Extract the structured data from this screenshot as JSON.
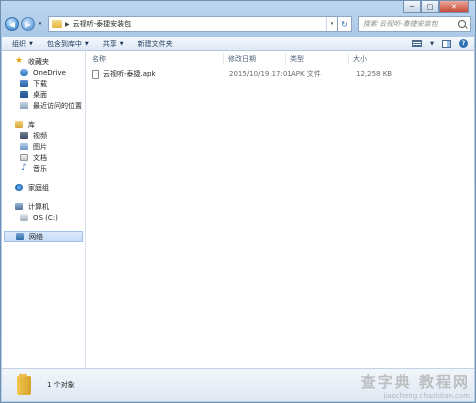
{
  "window": {
    "controls": {
      "minimize": "─",
      "maximize": "□",
      "close": "✕"
    }
  },
  "address_bar": {
    "back_icon": "◀",
    "forward_icon": "▶",
    "dropdown": "▾",
    "breadcrumb": [
      "云视听-泰捷安装包"
    ],
    "refresh": "↻"
  },
  "search": {
    "placeholder": "搜索 云视听-泰捷安装包"
  },
  "toolbar": {
    "items": [
      {
        "label": "组织",
        "has_dropdown": true
      },
      {
        "label": "包含到库中",
        "has_dropdown": true
      },
      {
        "label": "共享",
        "has_dropdown": true
      },
      {
        "label": "新建文件夹",
        "has_dropdown": false
      }
    ],
    "dropdown_glyph": "▼",
    "help": "?"
  },
  "sidebar": {
    "favorites": {
      "title": "收藏夹",
      "items": [
        {
          "label": "OneDrive"
        },
        {
          "label": "下载"
        },
        {
          "label": "桌面"
        },
        {
          "label": "最近访问的位置"
        }
      ]
    },
    "libraries": {
      "title": "库",
      "items": [
        {
          "label": "视频"
        },
        {
          "label": "图片"
        },
        {
          "label": "文档"
        },
        {
          "label": "音乐"
        }
      ]
    },
    "homegroup": {
      "title": "家庭组"
    },
    "computer": {
      "title": "计算机",
      "items": [
        {
          "label": "OS (C:)"
        }
      ]
    },
    "network": {
      "title": "网络"
    }
  },
  "columns": {
    "name": "名称",
    "modified": "修改日期",
    "type": "类型",
    "size": "大小"
  },
  "files": [
    {
      "name": "云视听-泰捷.apk",
      "modified": "2015/10/19 17:01",
      "type": "APK 文件",
      "size": "12,258 KB"
    }
  ],
  "status": {
    "count_text": "1 个对象"
  },
  "watermark": {
    "line1": "查字典 教程网",
    "line2": "jiaocheng.chazidian.com"
  },
  "colors": {
    "accent": "#2f6fb3",
    "window_frame": "#a9c7e6",
    "selected": "#c6dcf5"
  }
}
